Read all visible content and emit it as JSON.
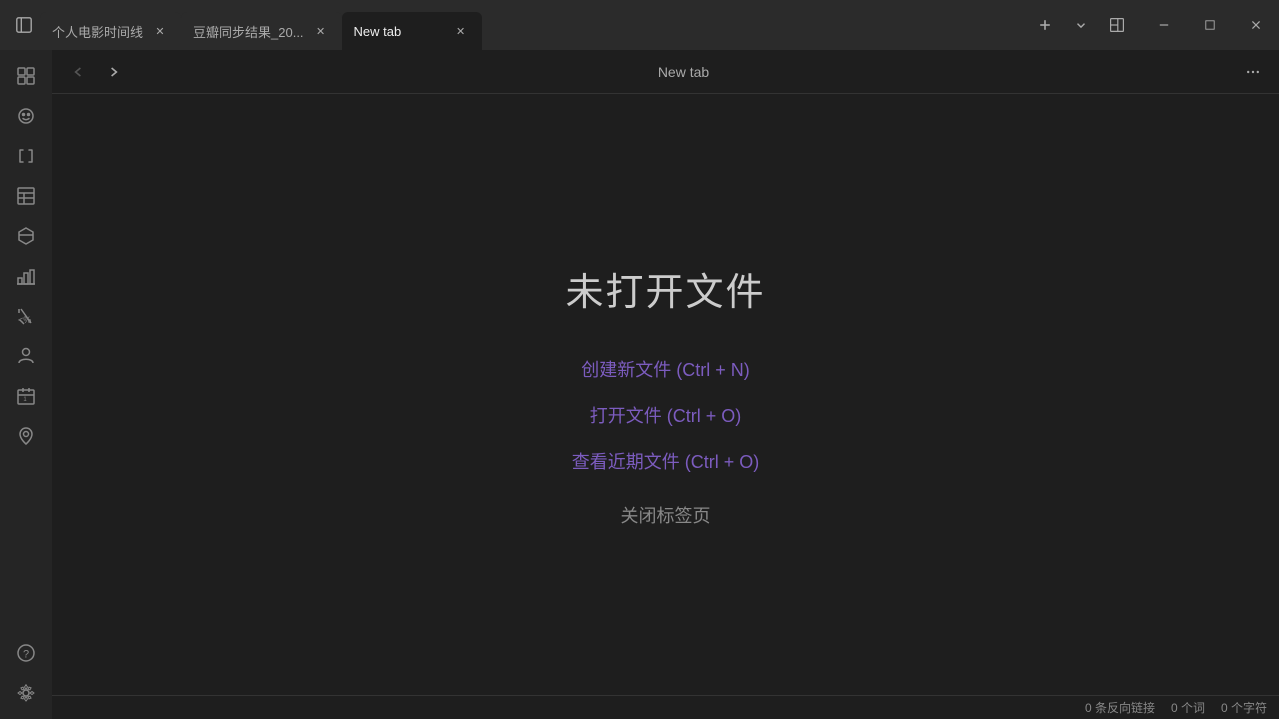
{
  "titlebar": {
    "sidebar_toggle_label": "☰",
    "tabs": [
      {
        "id": "tab1",
        "label": "个人电影时间线",
        "active": false
      },
      {
        "id": "tab2",
        "label": "豆瓣同步结果_20...",
        "active": false
      },
      {
        "id": "tab3",
        "label": "New tab",
        "active": true
      }
    ],
    "new_tab_label": "+",
    "chevron_label": "⌄",
    "layout_icon": "▣",
    "minimize_label": "─",
    "maximize_label": "□",
    "close_label": "✕"
  },
  "toolbar": {
    "back_label": "‹",
    "forward_label": "›",
    "center_title": "New tab",
    "more_label": "⋯"
  },
  "sidebar": {
    "icons": [
      {
        "name": "grid-icon",
        "symbol": "⊞"
      },
      {
        "name": "smiley-icon",
        "symbol": "☺"
      },
      {
        "name": "bracket-icon",
        "symbol": "[ ]"
      },
      {
        "name": "table-icon",
        "symbol": "⊞"
      },
      {
        "name": "filter-icon",
        "symbol": "⬡"
      },
      {
        "name": "chart-icon",
        "symbol": "▦"
      },
      {
        "name": "percent-icon",
        "symbol": "<%"
      },
      {
        "name": "person-icon",
        "symbol": "⊕"
      },
      {
        "name": "calendar-icon",
        "symbol": "📅"
      },
      {
        "name": "location-icon",
        "symbol": "📍"
      },
      {
        "name": "help-icon",
        "symbol": "?"
      },
      {
        "name": "settings-icon",
        "symbol": "⚙"
      }
    ]
  },
  "content": {
    "no_file_title": "未打开文件",
    "create_new": "创建新文件 (Ctrl + N)",
    "open_file": "打开文件 (Ctrl + O)",
    "view_recent": "查看近期文件 (Ctrl + O)",
    "close_tab": "关闭标签页"
  },
  "statusbar": {
    "backlinks": "0 条反向链接",
    "words": "0 个词",
    "chars": "0 个字符"
  }
}
